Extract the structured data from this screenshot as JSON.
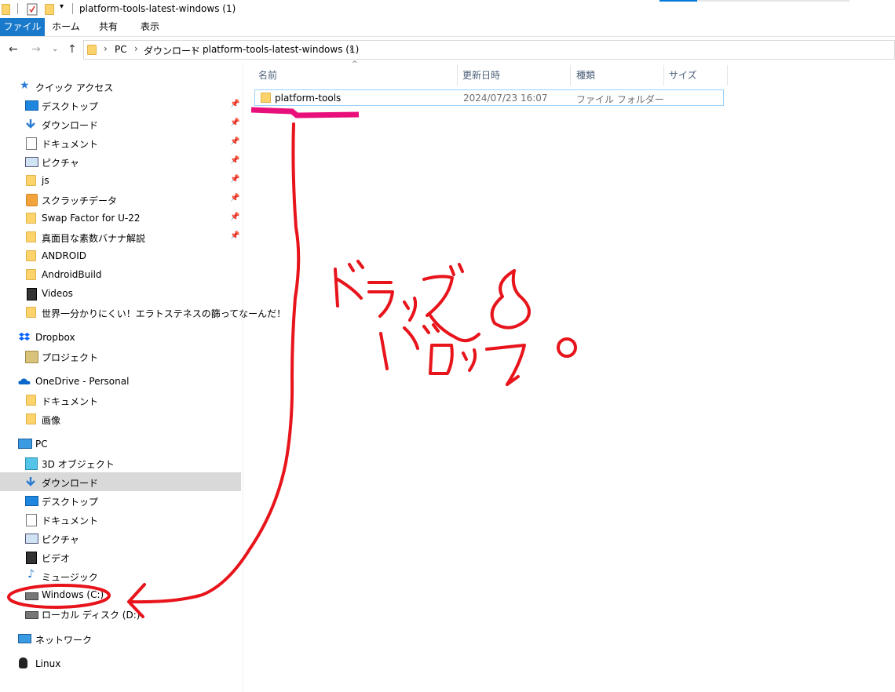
{
  "window": {
    "title": "platform-tools-latest-windows (1)"
  },
  "ribbon": {
    "tabs": [
      "ファイル",
      "ホーム",
      "共有",
      "表示"
    ]
  },
  "address": {
    "crumbs": [
      "PC",
      "ダウンロード",
      "platform-tools-latest-windows (1)"
    ]
  },
  "columns": {
    "name": "名前",
    "modified": "更新日時",
    "type": "種類",
    "size": "サイズ"
  },
  "files": [
    {
      "name": "platform-tools",
      "modified": "2024/07/23 16:07",
      "type": "ファイル フォルダー",
      "size": ""
    }
  ],
  "sidebar": {
    "quick_access": {
      "label": "クイック アクセス",
      "items": [
        {
          "label": "デスクトップ",
          "icon": "desktop-icon",
          "pinned": true
        },
        {
          "label": "ダウンロード",
          "icon": "download-icon",
          "pinned": true
        },
        {
          "label": "ドキュメント",
          "icon": "document-icon",
          "pinned": true
        },
        {
          "label": "ピクチャ",
          "icon": "picture-icon",
          "pinned": true
        },
        {
          "label": "js",
          "icon": "folder-icon",
          "pinned": true
        },
        {
          "label": "スクラッチデータ",
          "icon": "scratch-folder-icon",
          "pinned": true
        },
        {
          "label": "Swap Factor for U-22",
          "icon": "folder-icon",
          "pinned": true
        },
        {
          "label": "真面目な素数バナナ解説",
          "icon": "folder-icon",
          "pinned": true
        },
        {
          "label": "ANDROID",
          "icon": "folder-icon",
          "pinned": false
        },
        {
          "label": "AndroidBuild",
          "icon": "folder-icon",
          "pinned": false
        },
        {
          "label": "Videos",
          "icon": "video-folder-icon",
          "pinned": false
        },
        {
          "label": "世界一分かりにくい！エラトステネスの篩ってなーんだ！",
          "icon": "folder-icon",
          "pinned": false
        }
      ]
    },
    "dropbox": {
      "label": "Dropbox",
      "items": [
        {
          "label": "プロジェクト",
          "icon": "project-folder-icon"
        }
      ]
    },
    "onedrive": {
      "label": "OneDrive - Personal",
      "items": [
        {
          "label": "ドキュメント",
          "icon": "folder-icon"
        },
        {
          "label": "画像",
          "icon": "folder-icon"
        }
      ]
    },
    "pc": {
      "label": "PC",
      "items": [
        {
          "label": "3D オブジェクト",
          "icon": "3d-objects-icon"
        },
        {
          "label": "ダウンロード",
          "icon": "download-icon",
          "selected": true
        },
        {
          "label": "デスクトップ",
          "icon": "desktop-icon"
        },
        {
          "label": "ドキュメント",
          "icon": "document-icon"
        },
        {
          "label": "ピクチャ",
          "icon": "picture-icon"
        },
        {
          "label": "ビデオ",
          "icon": "video-icon"
        },
        {
          "label": "ミュージック",
          "icon": "music-icon"
        },
        {
          "label": "Windows (C:)",
          "icon": "drive-windows-icon"
        },
        {
          "label": "ローカル ディスク (D:)",
          "icon": "drive-icon"
        }
      ]
    },
    "network": {
      "label": "ネットワーク"
    },
    "linux": {
      "label": "Linux"
    }
  },
  "colors": {
    "accent": "#1979ca",
    "annotation_red": "#e8141b",
    "annotation_magenta": "#e80f7b",
    "selection": "#d9d9d9"
  }
}
